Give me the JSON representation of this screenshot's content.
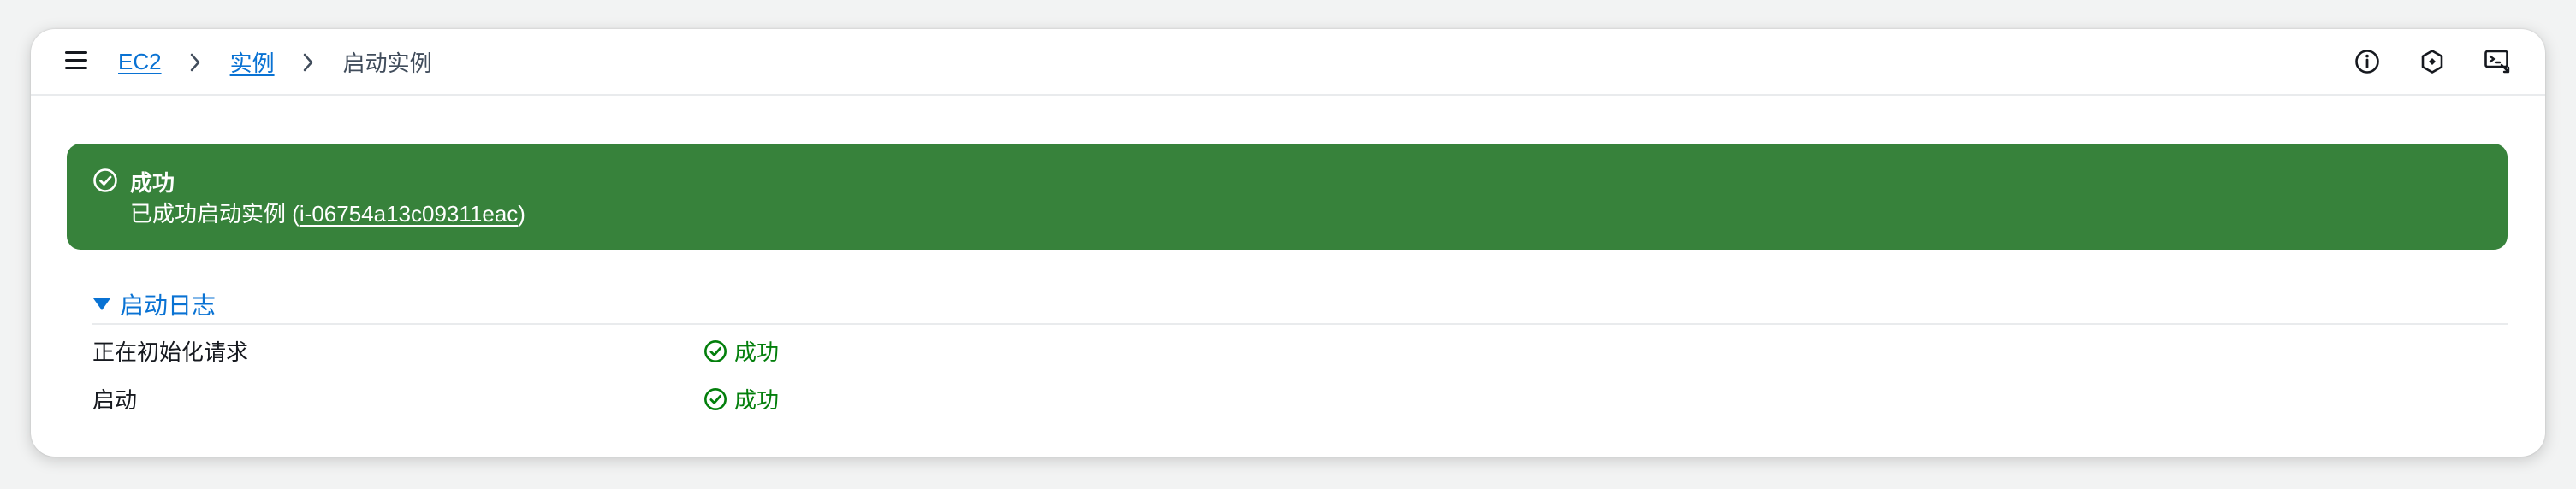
{
  "breadcrumb": {
    "items": [
      {
        "label": "EC2"
      },
      {
        "label": "实例"
      },
      {
        "label": "启动实例"
      }
    ]
  },
  "header_icons": [
    "info-icon",
    "feedback-icon",
    "cloudshell-icon"
  ],
  "flash": {
    "title": "成功",
    "message_prefix": "已成功启动实例 (",
    "instance_id": "i-06754a13c09311eac",
    "message_suffix": ")",
    "color": "#37823b"
  },
  "launch_log": {
    "title": "启动日志",
    "rows": [
      {
        "step": "正在初始化请求",
        "status": "成功"
      },
      {
        "step": "启动",
        "status": "成功"
      }
    ],
    "status_color": "#037f0c"
  },
  "colors": {
    "link": "#0972d3",
    "success_flash": "#37823b",
    "success_text": "#037f0c"
  }
}
